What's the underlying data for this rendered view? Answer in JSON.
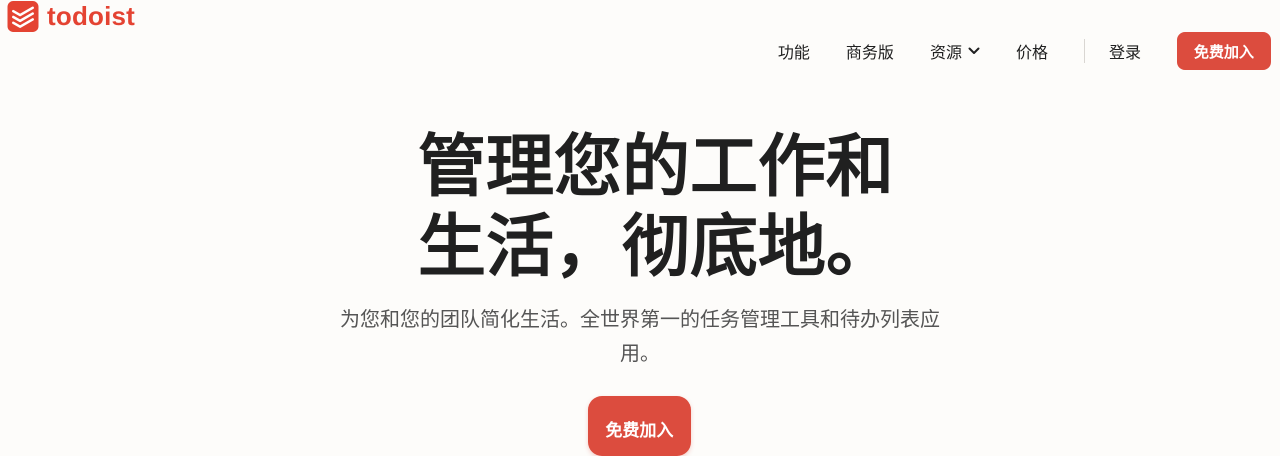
{
  "brand": {
    "name": "todoist",
    "color": "#e44332"
  },
  "nav": {
    "items": [
      {
        "label": "功能"
      },
      {
        "label": "商务版"
      },
      {
        "label": "资源",
        "has_dropdown": true
      },
      {
        "label": "价格"
      }
    ],
    "login_label": "登录",
    "signup_label": "免费加入"
  },
  "hero": {
    "title_line1": "管理您的工作和",
    "title_line2": "生活，彻底地。",
    "subtitle": "为您和您的团队简化生活。全世界第一的任务管理工具和待办列表应用。",
    "cta_label": "免费加入"
  },
  "colors": {
    "accent": "#dc4c3e",
    "background": "#fdfcfa",
    "text": "#202020",
    "muted_text": "#555555"
  },
  "icons": {
    "logo": "todoist-logo-icon",
    "dropdown": "chevron-down-icon"
  }
}
